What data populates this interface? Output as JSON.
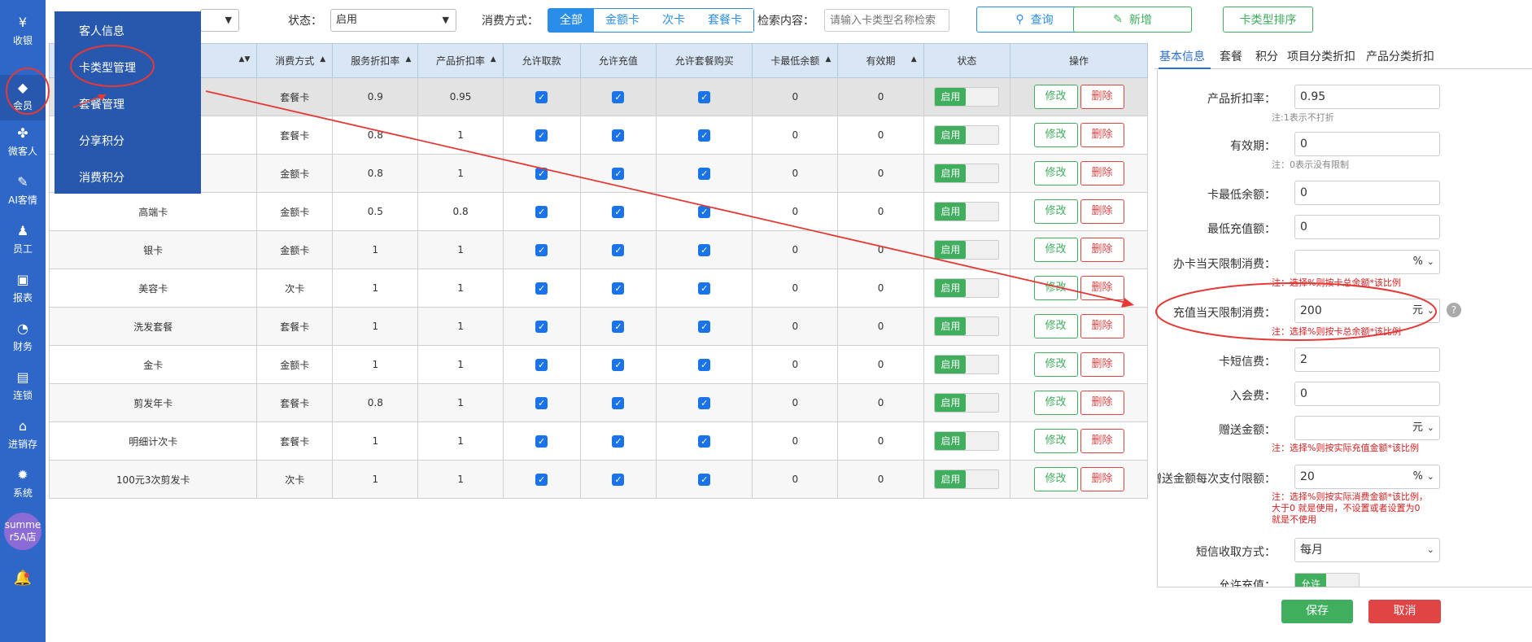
{
  "nav": {
    "items": [
      {
        "label": "收银",
        "icon": "¥"
      },
      {
        "label": "会员",
        "icon": "◆"
      },
      {
        "label": "微客人",
        "icon": "✤"
      },
      {
        "label": "AI客情",
        "icon": "✎"
      },
      {
        "label": "员工",
        "icon": "♟"
      },
      {
        "label": "报表",
        "icon": "▣"
      },
      {
        "label": "财务",
        "icon": "◔"
      },
      {
        "label": "连锁",
        "icon": "▤"
      },
      {
        "label": "进销存",
        "icon": "⌂"
      },
      {
        "label": "系统",
        "icon": "✹"
      }
    ],
    "avatar_line1": "summe",
    "avatar_line2": "r5A店",
    "bell_icon": "🔔"
  },
  "flyout": {
    "items": [
      "客人信息",
      "卡类型管理",
      "套餐管理",
      "分享积分",
      "消费积分"
    ]
  },
  "toolbar": {
    "status_label": "状态：",
    "status_value": "启用",
    "pay_label": "消费方式：",
    "pay_options": [
      "全部",
      "金额卡",
      "次卡",
      "套餐卡"
    ],
    "pay_selected": "全部",
    "search_label": "检索内容：",
    "search_placeholder": "请输入卡类型名称检索",
    "query_label": "查询",
    "add_label": "新增",
    "sort_label": "卡类型排序"
  },
  "table": {
    "headers": [
      "",
      "消费方式",
      "服务折扣率",
      "产品折扣率",
      "允许取款",
      "允许充值",
      "允许套餐购买",
      "卡最低余额",
      "有效期",
      "状态",
      "操作"
    ],
    "rows": [
      {
        "name": "",
        "pay": "套餐卡",
        "svc": "0.9",
        "prod": "0.95",
        "min": "0",
        "valid": "0"
      },
      {
        "name": "",
        "pay": "套餐卡",
        "svc": "0.8",
        "prod": "1",
        "min": "0",
        "valid": "0"
      },
      {
        "name": "",
        "pay": "金额卡",
        "svc": "0.8",
        "prod": "1",
        "min": "0",
        "valid": "0"
      },
      {
        "name": "高端卡",
        "pay": "金额卡",
        "svc": "0.5",
        "prod": "0.8",
        "min": "0",
        "valid": "0"
      },
      {
        "name": "银卡",
        "pay": "金额卡",
        "svc": "1",
        "prod": "1",
        "min": "0",
        "valid": "0"
      },
      {
        "name": "美容卡",
        "pay": "次卡",
        "svc": "1",
        "prod": "1",
        "min": "0",
        "valid": "0"
      },
      {
        "name": "洗发套餐",
        "pay": "套餐卡",
        "svc": "1",
        "prod": "1",
        "min": "0",
        "valid": "0"
      },
      {
        "name": "金卡",
        "pay": "金额卡",
        "svc": "1",
        "prod": "1",
        "min": "0",
        "valid": "0"
      },
      {
        "name": "剪发年卡",
        "pay": "套餐卡",
        "svc": "0.8",
        "prod": "1",
        "min": "0",
        "valid": "0"
      },
      {
        "name": "明细计次卡",
        "pay": "套餐卡",
        "svc": "1",
        "prod": "1",
        "min": "0",
        "valid": "0"
      },
      {
        "name": "100元3次剪发卡",
        "pay": "次卡",
        "svc": "1",
        "prod": "1",
        "min": "0",
        "valid": "0"
      }
    ],
    "toggle_label": "启用",
    "edit_label": "修改",
    "delete_label": "删除"
  },
  "panel": {
    "tabs": [
      "基本信息",
      "套餐",
      "积分",
      "项目分类折扣",
      "产品分类折扣"
    ],
    "fields": {
      "prod_discount_label": "产品折扣率：",
      "prod_discount_value": "0.95",
      "prod_discount_note": "注:1表示不打折",
      "validity_label": "有效期：",
      "validity_value": "0",
      "validity_note": "注：0表示没有限制",
      "min_balance_label": "卡最低余额：",
      "min_balance_value": "0",
      "min_recharge_label": "最低充值额：",
      "min_recharge_value": "0",
      "open_limit_label": "办卡当天限制消费：",
      "open_limit_value": "",
      "open_limit_unit": "%",
      "open_limit_note": "注：选择%则按卡总余额*该比例",
      "recharge_limit_label": "充值当天限制消费：",
      "recharge_limit_value": "200",
      "recharge_limit_unit": "元",
      "recharge_limit_note": "注：选择%则按卡总余额*该比例",
      "sms_fee_label": "卡短信费：",
      "sms_fee_value": "2",
      "join_fee_label": "入会费：",
      "join_fee_value": "0",
      "gift_label": "赠送金额：",
      "gift_value": "",
      "gift_unit": "元",
      "gift_note": "注：选择%则按实际充值金额*该比例",
      "gift_pay_label": "赠送金额每次支付限额：",
      "gift_pay_value": "20",
      "gift_pay_unit": "%",
      "gift_pay_note1": "注：选择%则按实际消费金额*该比例，",
      "gift_pay_note2": "大于0 就是使用，不设置或者设置为0",
      "gift_pay_note3": "就是不使用",
      "sms_mode_label": "短信收取方式：",
      "sms_mode_value": "每月",
      "allow_recharge_label": "允许充值：",
      "allow_recharge_toggle": "允许"
    },
    "save_label": "保存",
    "cancel_label": "取消"
  }
}
